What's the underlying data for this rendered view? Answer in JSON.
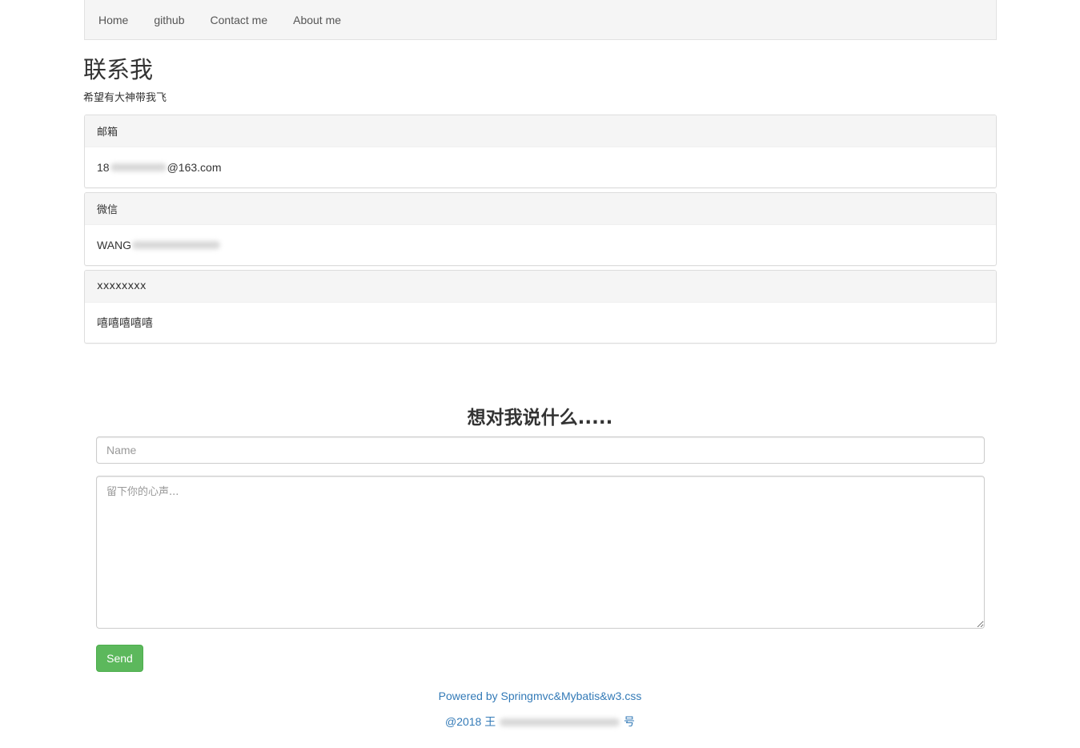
{
  "nav": {
    "items": [
      {
        "label": "Home"
      },
      {
        "label": "github"
      },
      {
        "label": "Contact me"
      },
      {
        "label": "About me"
      }
    ]
  },
  "page": {
    "title": "联系我",
    "subtitle": "希望有大神带我飞"
  },
  "panels": [
    {
      "heading": "邮箱",
      "value_prefix": "18",
      "value_suffix": "@163.com"
    },
    {
      "heading": "微信",
      "value_prefix": "WANG",
      "value_suffix": ""
    },
    {
      "heading": "xxxxxxxx",
      "value_prefix": "嘻嘻嘻嘻嘻",
      "value_suffix": ""
    }
  ],
  "form": {
    "title": "想对我说什么.....",
    "name_placeholder": "Name",
    "message_placeholder": "留下你的心声...",
    "send_label": "Send"
  },
  "footer": {
    "powered_by": "Powered by Springmvc&Mybatis&w3.css",
    "copyright_prefix": "@2018 王",
    "copyright_suffix": "号"
  },
  "colors": {
    "link": "#337ab7",
    "send_button": "#5cb85c",
    "panel_heading": "#f5f5f5"
  }
}
